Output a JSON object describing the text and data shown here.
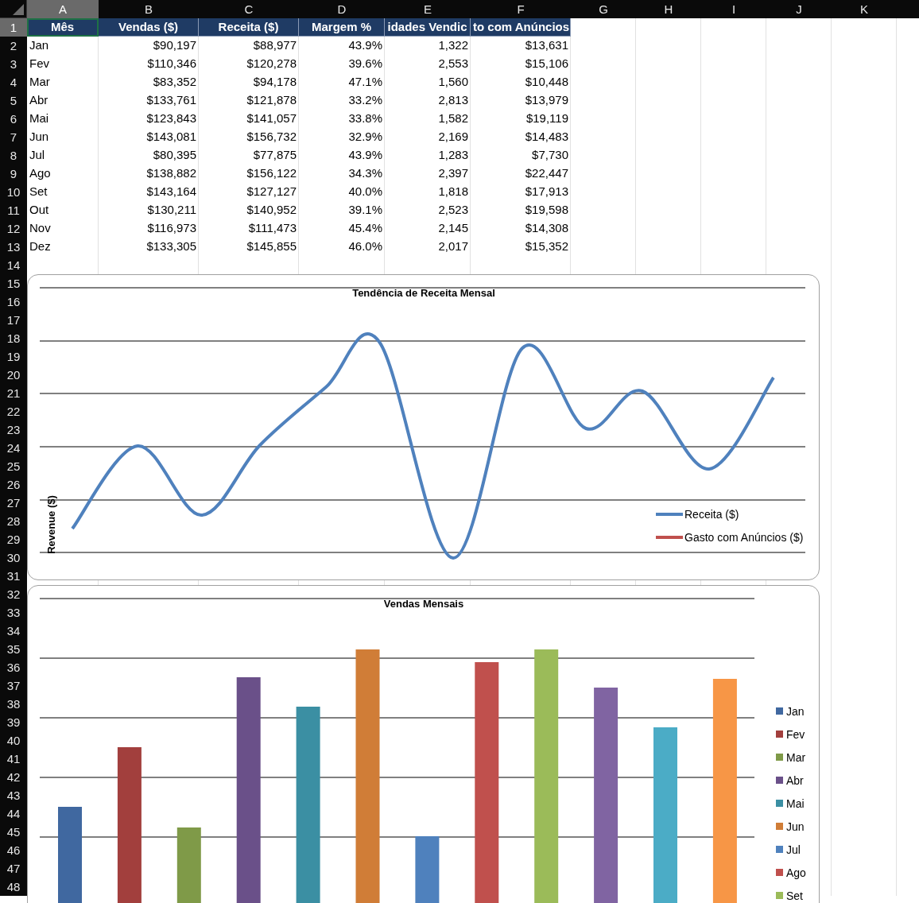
{
  "column_headers": [
    {
      "label": "A",
      "selected": true
    },
    {
      "label": "B",
      "selected": false
    },
    {
      "label": "C",
      "selected": false
    },
    {
      "label": "D",
      "selected": false
    },
    {
      "label": "E",
      "selected": false
    },
    {
      "label": "F",
      "selected": false
    },
    {
      "label": "G",
      "selected": false
    },
    {
      "label": "H",
      "selected": false
    },
    {
      "label": "I",
      "selected": false
    },
    {
      "label": "J",
      "selected": false
    },
    {
      "label": "K",
      "selected": false
    }
  ],
  "rows": [
    {
      "number": "1",
      "selected": true,
      "kind": "header",
      "cells": [
        "Mês",
        "Vendas ($)",
        "Receita ($)",
        "Margem %",
        "idades Vendic",
        "to com Anúncios"
      ]
    },
    {
      "number": "2",
      "selected": false,
      "kind": "data",
      "cells": [
        "Jan",
        "$90,197",
        "$88,977",
        "43.9%",
        "1,322",
        "$13,631"
      ]
    },
    {
      "number": "3",
      "selected": false,
      "kind": "data",
      "cells": [
        "Fev",
        "$110,346",
        "$120,278",
        "39.6%",
        "2,553",
        "$15,106"
      ]
    },
    {
      "number": "4",
      "selected": false,
      "kind": "data",
      "cells": [
        "Mar",
        "$83,352",
        "$94,178",
        "47.1%",
        "1,560",
        "$10,448"
      ]
    },
    {
      "number": "5",
      "selected": false,
      "kind": "data",
      "cells": [
        "Abr",
        "$133,761",
        "$121,878",
        "33.2%",
        "2,813",
        "$13,979"
      ]
    },
    {
      "number": "6",
      "selected": false,
      "kind": "data",
      "cells": [
        "Mai",
        "$123,843",
        "$141,057",
        "33.8%",
        "1,582",
        "$19,119"
      ]
    },
    {
      "number": "7",
      "selected": false,
      "kind": "data",
      "cells": [
        "Jun",
        "$143,081",
        "$156,732",
        "32.9%",
        "2,169",
        "$14,483"
      ]
    },
    {
      "number": "8",
      "selected": false,
      "kind": "data",
      "cells": [
        "Jul",
        "$80,395",
        "$77,875",
        "43.9%",
        "1,283",
        "$7,730"
      ]
    },
    {
      "number": "9",
      "selected": false,
      "kind": "data",
      "cells": [
        "Ago",
        "$138,882",
        "$156,122",
        "34.3%",
        "2,397",
        "$22,447"
      ]
    },
    {
      "number": "10",
      "selected": false,
      "kind": "data",
      "cells": [
        "Set",
        "$143,164",
        "$127,127",
        "40.0%",
        "1,818",
        "$17,913"
      ]
    },
    {
      "number": "11",
      "selected": false,
      "kind": "data",
      "cells": [
        "Out",
        "$130,211",
        "$140,952",
        "39.1%",
        "2,523",
        "$19,598"
      ]
    },
    {
      "number": "12",
      "selected": false,
      "kind": "data",
      "cells": [
        "Nov",
        "$116,973",
        "$111,473",
        "45.4%",
        "2,145",
        "$14,308"
      ]
    },
    {
      "number": "13",
      "selected": false,
      "kind": "data",
      "cells": [
        "Dez",
        "$133,305",
        "$145,855",
        "46.0%",
        "2,017",
        "$15,352"
      ]
    },
    {
      "number": "14",
      "selected": false,
      "kind": "data"
    },
    {
      "number": "15",
      "selected": false,
      "kind": "data"
    },
    {
      "number": "16",
      "selected": false,
      "kind": "data"
    },
    {
      "number": "17",
      "selected": false,
      "kind": "data"
    },
    {
      "number": "18",
      "selected": false,
      "kind": "data"
    },
    {
      "number": "19",
      "selected": false,
      "kind": "data"
    },
    {
      "number": "20",
      "selected": false,
      "kind": "data"
    },
    {
      "number": "21",
      "selected": false,
      "kind": "data"
    },
    {
      "number": "22",
      "selected": false,
      "kind": "data"
    },
    {
      "number": "23",
      "selected": false,
      "kind": "data"
    },
    {
      "number": "24",
      "selected": false,
      "kind": "data"
    },
    {
      "number": "25",
      "selected": false,
      "kind": "data"
    },
    {
      "number": "26",
      "selected": false,
      "kind": "data"
    },
    {
      "number": "27",
      "selected": false,
      "kind": "data"
    },
    {
      "number": "28",
      "selected": false,
      "kind": "data"
    },
    {
      "number": "29",
      "selected": false,
      "kind": "data"
    },
    {
      "number": "30",
      "selected": false,
      "kind": "data"
    },
    {
      "number": "31",
      "selected": false,
      "kind": "data"
    },
    {
      "number": "32",
      "selected": false,
      "kind": "data"
    },
    {
      "number": "33",
      "selected": false,
      "kind": "data"
    },
    {
      "number": "34",
      "selected": false,
      "kind": "data"
    },
    {
      "number": "35",
      "selected": false,
      "kind": "data"
    },
    {
      "number": "36",
      "selected": false,
      "kind": "data"
    },
    {
      "number": "37",
      "selected": false,
      "kind": "data"
    },
    {
      "number": "38",
      "selected": false,
      "kind": "data"
    },
    {
      "number": "39",
      "selected": false,
      "kind": "data"
    },
    {
      "number": "40",
      "selected": false,
      "kind": "data"
    },
    {
      "number": "41",
      "selected": false,
      "kind": "data"
    },
    {
      "number": "42",
      "selected": false,
      "kind": "data"
    },
    {
      "number": "43",
      "selected": false,
      "kind": "data"
    },
    {
      "number": "44",
      "selected": false,
      "kind": "data"
    },
    {
      "number": "45",
      "selected": false,
      "kind": "data"
    },
    {
      "number": "46",
      "selected": false,
      "kind": "data"
    },
    {
      "number": "47",
      "selected": false,
      "kind": "data"
    },
    {
      "number": "48",
      "selected": false,
      "kind": "data"
    }
  ],
  "charts": [
    {
      "kind": "line",
      "title": "Tendência de Receita Mensal",
      "ylabel": "Revenue ($)",
      "legend": [
        {
          "label": "Receita ($)",
          "color": "#4f81bd"
        },
        {
          "label": "Gasto com Anúncios ($)",
          "color": "#c0504d"
        }
      ]
    },
    {
      "kind": "bar",
      "title": "Vendas Mensais",
      "legend": [
        {
          "label": "Jan",
          "color": "#4068a0"
        },
        {
          "label": "Fev",
          "color": "#a23f3d"
        },
        {
          "label": "Mar",
          "color": "#7f9a48"
        },
        {
          "label": "Abr",
          "color": "#6a5089"
        },
        {
          "label": "Mai",
          "color": "#3b8fa3"
        },
        {
          "label": "Jun",
          "color": "#d07d37"
        },
        {
          "label": "Jul",
          "color": "#4f81bd"
        },
        {
          "label": "Ago",
          "color": "#c0504d"
        },
        {
          "label": "Set",
          "color": "#9bbb59"
        }
      ]
    }
  ]
}
